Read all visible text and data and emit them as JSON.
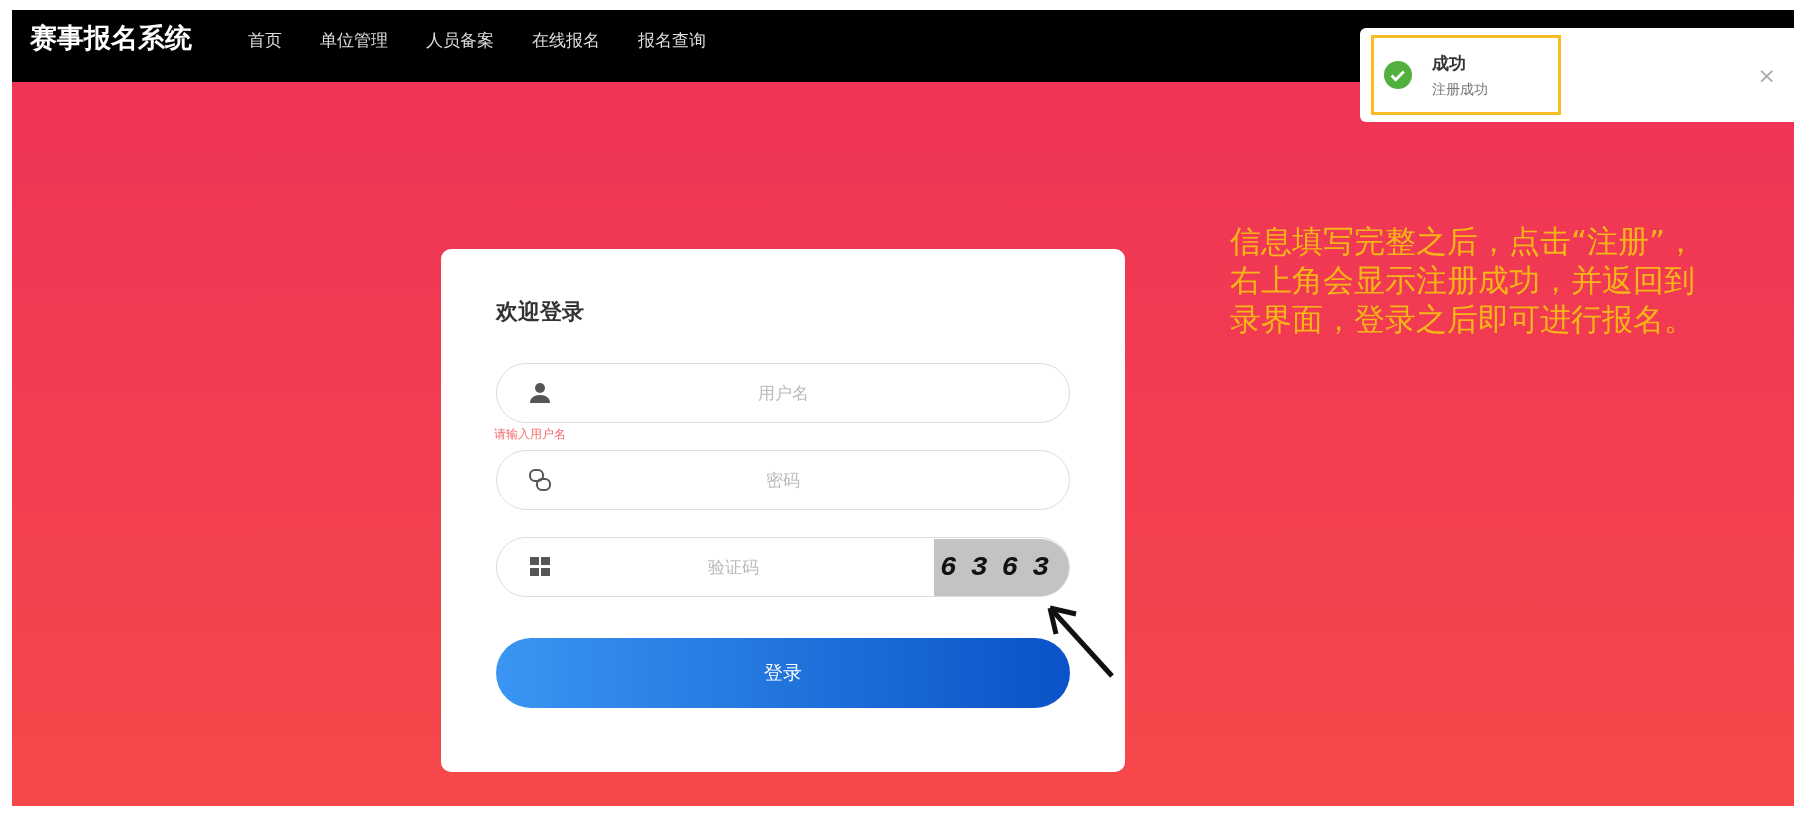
{
  "header": {
    "title": "赛事报名系统",
    "nav": [
      {
        "label": "首页",
        "selected": false
      },
      {
        "label": "单位管理",
        "selected": false
      },
      {
        "label": "人员备案",
        "selected": false
      },
      {
        "label": "在线报名",
        "selected": false
      },
      {
        "label": "报名查询",
        "selected": false
      }
    ]
  },
  "toast": {
    "title": "成功",
    "message": "注册成功",
    "close": "×",
    "highlighted": true
  },
  "login": {
    "title": "欢迎登录",
    "fields": [
      {
        "kind": "user",
        "placeholder": "用户名",
        "error": "请输入用户名"
      },
      {
        "kind": "password",
        "placeholder": "密码"
      },
      {
        "kind": "captcha",
        "placeholder": "验证码",
        "captcha": "6363"
      }
    ],
    "button": "登录"
  },
  "annotation": {
    "lines": [
      "信息填写完整之后，点击“注册”，",
      "右上角会显示注册成功，并返回到",
      "录界面，登录之后即可进行报名。"
    ]
  }
}
